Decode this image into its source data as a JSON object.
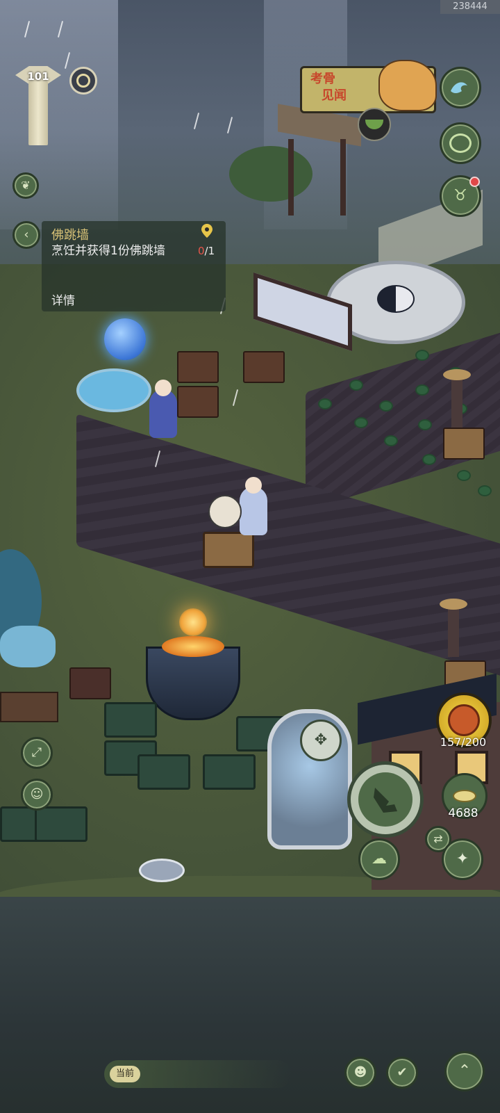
{
  "top_id": "238444",
  "player": {
    "level": "101"
  },
  "quest": {
    "title": "佛跳墙",
    "description": "烹饪并获得1份佛跳墙",
    "progress_current": "0",
    "progress_total": "/1",
    "detail_label": "详情"
  },
  "event": {
    "line1": "考骨",
    "line2": "见闻"
  },
  "resources": {
    "stamina": "157/200",
    "coins": "4688"
  },
  "chat": {
    "channel_label": "当前"
  },
  "icons": {
    "back": "chevron-left-icon",
    "location": "location-pin-icon",
    "wave": "wave-icon",
    "bag": "pouch-icon",
    "creature": "horned-creature-icon",
    "leaf": "leaf-icon",
    "coin": "coin-icon",
    "tap": "tap-hand-icon",
    "cloud": "cloud-icon",
    "compass": "compass-icon",
    "shuriken": "shuriken-icon",
    "swap": "swap-icon",
    "expand": "expand-arrows-icon",
    "avatar": "avatar-icon",
    "emoji": "smile-icon",
    "check": "check-icon",
    "up": "chevron-up-icon"
  },
  "colors": {
    "quest_title": "#d8c277",
    "progress_red": "#e8554a",
    "button_green": "#4f6a48",
    "banner_text": "#c7472c",
    "banner_bg": "#c2b46a",
    "stamina_gold": "#f6d94a"
  }
}
